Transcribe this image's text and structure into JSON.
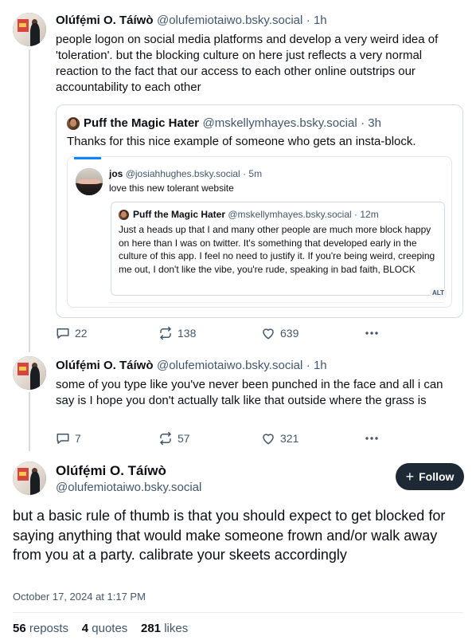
{
  "post1": {
    "author": "Olúfẹ́mi O. Táíwò",
    "handle": "@olufemiotaiwo.bsky.social",
    "time": "· 1h",
    "text": "people logon on social media platforms and develop a very weird idea of 'toleration'. but the blocking culture on here just reflects a very normal reaction to the fact that our access to each other online outstrips our accountability to each other",
    "quote": {
      "author": "Puff the Magic Hater",
      "handle": "@mskellymhayes.bsky.social",
      "time": "· 3h",
      "text": "Thanks for this nice example of someone who gets an insta-block.",
      "inner": {
        "author": "jos",
        "handle": "@josiahhughes.bsky.social",
        "time": "· 5m",
        "text": "love this new tolerant website",
        "inner_quote": {
          "author": "Puff the Magic Hater",
          "handle": "@mskellymhayes.bsky.social",
          "time": "· 12m",
          "text": "Just a heads up that I and many other people are much more block happy on here than I was on twitter. It's something that developed early in the culture of this app. I feel no need to justify it. If you're being weird, creeping me out, I don't like the vibe, you're rude, speaking in bad faith, BLOCK"
        },
        "alt_badge": "ALT"
      }
    },
    "replies": "22",
    "reposts": "138",
    "likes": "639"
  },
  "post2": {
    "author": "Olúfẹ́mi O. Táíwò",
    "handle": "@olufemiotaiwo.bsky.social",
    "time": "· 1h",
    "text": "some of you type like you've never been punched in the face and all i can say is I hope you don't actually talk like that outside where the grass is",
    "replies": "7",
    "reposts": "57",
    "likes": "321"
  },
  "main": {
    "author": "Olúfẹ́mi O. Táíwò",
    "handle": "@olufemiotaiwo.bsky.social",
    "follow_label": "Follow",
    "text": "but a basic rule of thumb is that you should expect to get blocked for saying anything that would make someone frown and/or walk away from you at a party. calibrate your skeets accordingly",
    "date": "October 17, 2024 at 1:17 PM",
    "stats": {
      "reposts_count": "56",
      "reposts_label": "reposts",
      "quotes_count": "4",
      "quotes_label": "quotes",
      "likes_count": "281",
      "likes_label": "likes"
    }
  },
  "colors": {
    "muted": "#42576c",
    "border": "#d4dbe2",
    "follow_bg": "#1e2936",
    "accent": "#1083fe"
  }
}
